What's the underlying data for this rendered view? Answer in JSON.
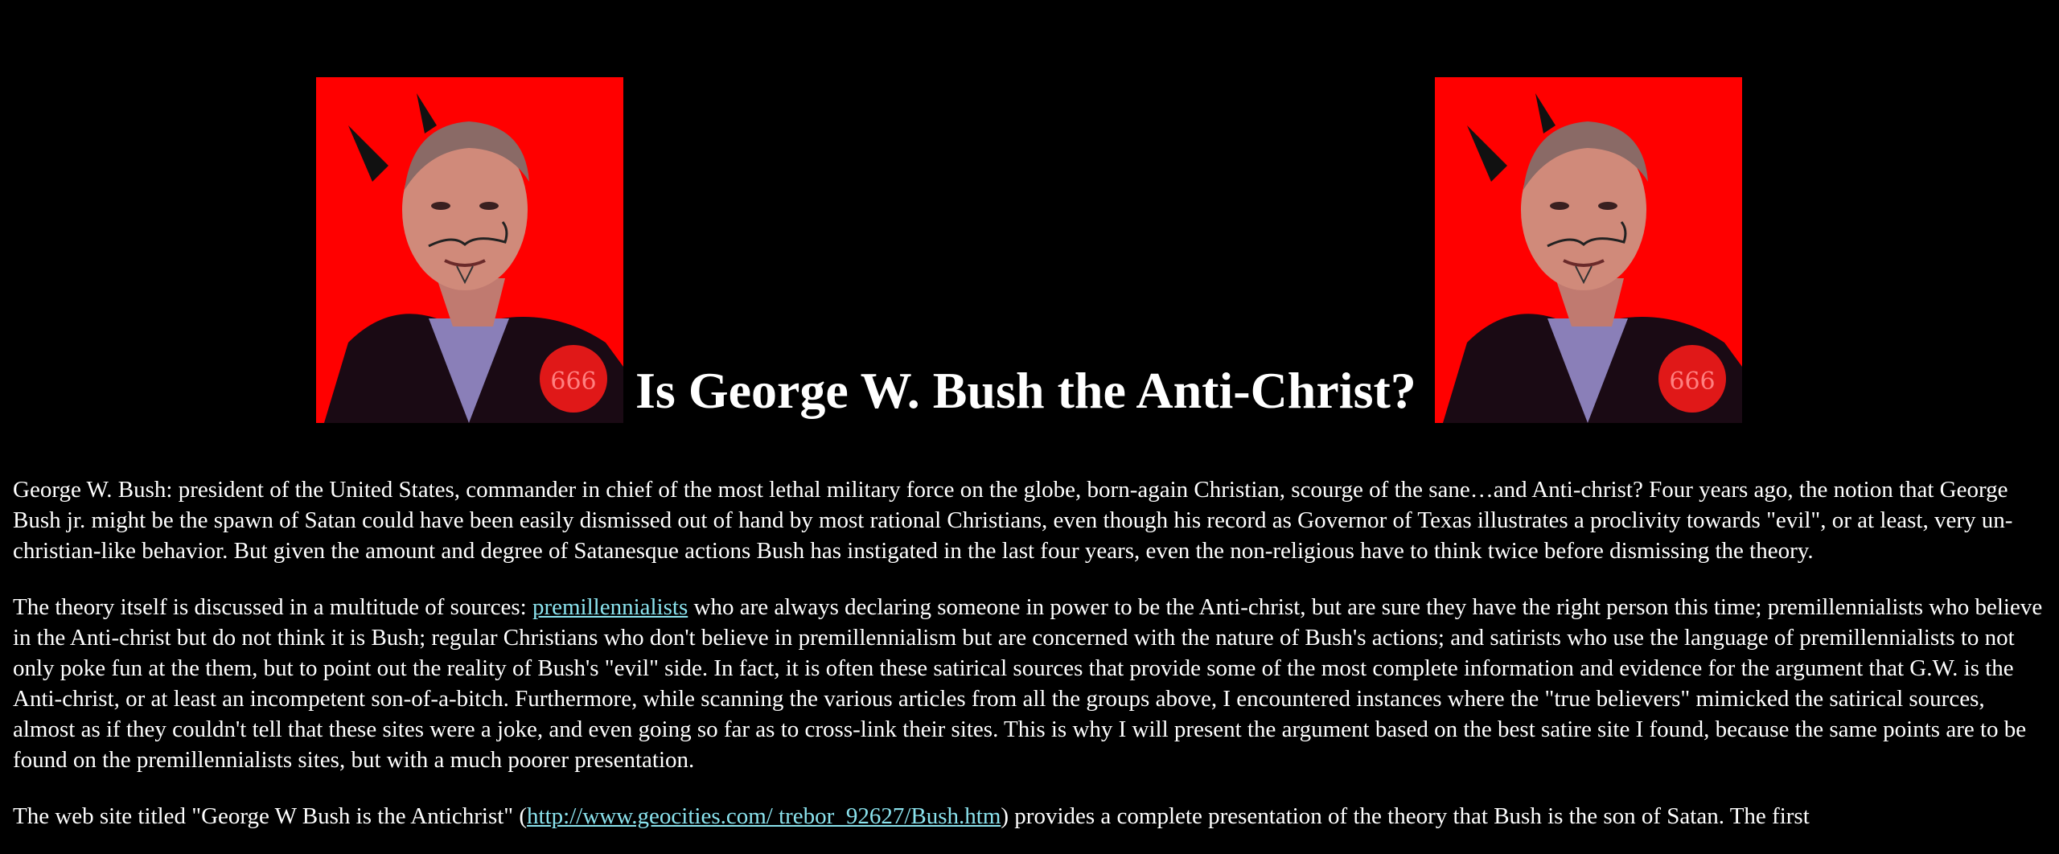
{
  "colors": {
    "background": "#000000",
    "text": "#ffffff",
    "link": "#8be3ee",
    "portrait_background": "#ff0000"
  },
  "images": {
    "left_portrait": "devil-horned-bush-portrait",
    "right_portrait": "devil-horned-bush-portrait",
    "badge_text": "666"
  },
  "page": {
    "title": "Is George W. Bush the Anti-Christ?"
  },
  "paragraphs": {
    "p1": "George W. Bush: president of the United States, commander in chief of the most lethal military force on the globe, born-again Christian, scourge of the sane…and Anti-christ? Four years ago, the notion that George Bush jr. might be the spawn of Satan could have been easily dismissed out of hand by most rational Christians, even though his record as Governor of Texas illustrates a proclivity towards \"evil\", or at least, very un-christian-like behavior. But given the amount and degree of Satanesque actions Bush has instigated in the last four years, even the non-religious have to think twice before dismissing the theory.",
    "p2_before": "The theory itself is discussed in a multitude of sources: ",
    "p2_link": "premillennialists",
    "p2_after": " who are always declaring someone in power to be the Anti-christ, but are sure they have the right person this time; premillennialists who believe in the Anti-christ but do not think it is Bush; regular Christians who don't believe in premillennialism but are concerned with the nature of Bush's actions; and satirists who use the language of premillennialists to not only poke fun at the them, but to point out the reality of Bush's \"evil\" side. In fact, it is often these satirical sources that provide some of the most complete information and evidence for the argument that G.W. is the Anti-christ, or at least an incompetent son-of-a-bitch. Furthermore, while scanning the various articles from all the groups above, I encountered instances where the \"true believers\" mimicked the satirical sources, almost as if they couldn't tell that these sites were a joke, and even going so far as to cross-link their sites. This is why I will present the argument based on the best satire site I found, because the same points are to be found on the premillennialists sites, but with a much poorer presentation.",
    "p3_before": "The web site titled \"George W Bush is the Antichrist\" (",
    "p3_link": "http://www.geocities.com/ trebor_92627/Bush.htm",
    "p3_after": ") provides a complete presentation of the theory that Bush is the son of Satan. The first"
  }
}
